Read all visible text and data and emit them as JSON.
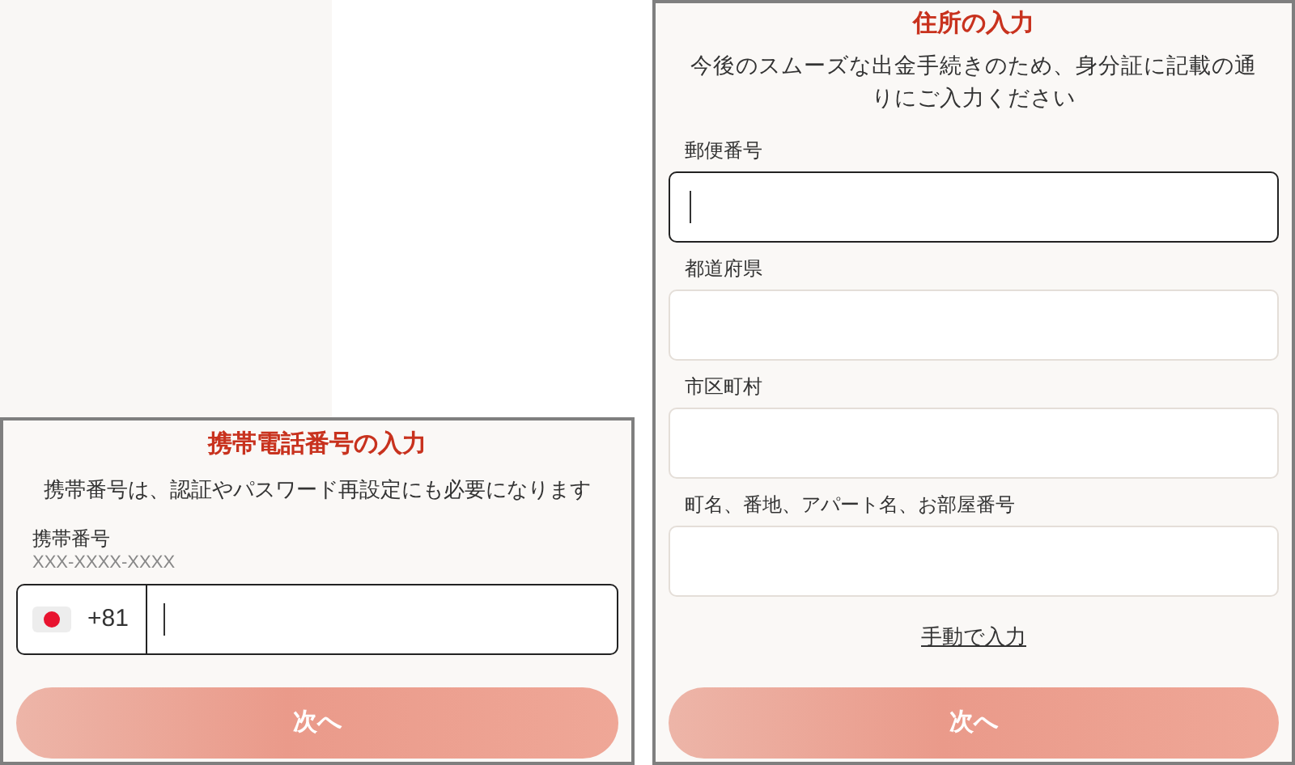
{
  "phone_form": {
    "title": "携帯電話番号の入力",
    "subtitle": "携帯番号は、認証やパスワード再設定にも必要になります",
    "field": {
      "label": "携帯番号",
      "hint": "XXX-XXXX-XXXX",
      "country_code": "+81",
      "focused": true
    },
    "next_button": {
      "label": "次へ",
      "disabled": true
    }
  },
  "address_form": {
    "title": "住所の入力",
    "subtitle": "今後のスムーズな出金手続きのため、身分証に記載の通りにご入力ください",
    "fields": [
      {
        "label": "郵便番号",
        "focused": true
      },
      {
        "label": "都道府県",
        "focused": false
      },
      {
        "label": "市区町村",
        "focused": false
      },
      {
        "label": "町名、番地、アパート名、お部屋番号",
        "focused": false
      }
    ],
    "manual_link": "手動で入力",
    "next_button": {
      "label": "次へ",
      "disabled": true
    }
  }
}
